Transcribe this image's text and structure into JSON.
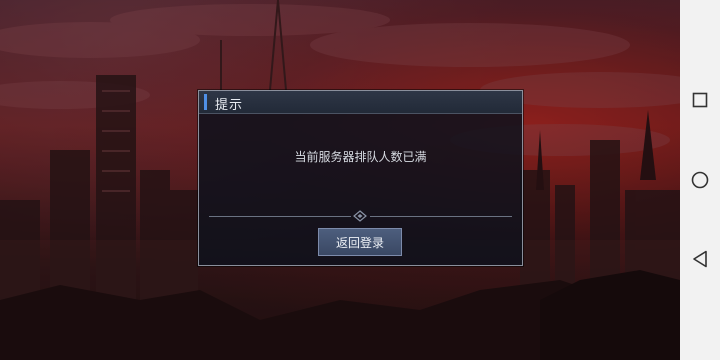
{
  "dialog": {
    "title": "提示",
    "message": "当前服务器排队人数已满",
    "confirm_label": "返回登录"
  },
  "nav": {
    "recent_icon": "square-icon",
    "home_icon": "circle-icon",
    "back_icon": "triangle-back-icon"
  },
  "colors": {
    "accent": "#4f8fe6",
    "button": "#3a4864",
    "sky_red": "#6e2022"
  }
}
